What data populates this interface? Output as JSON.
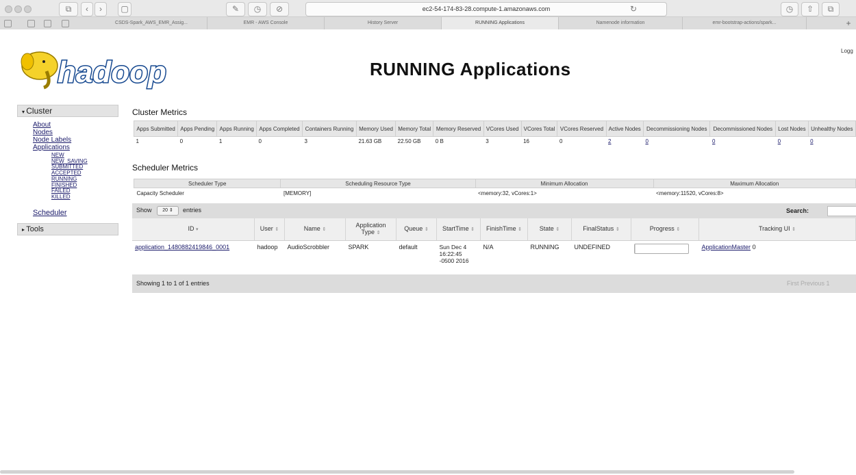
{
  "browser": {
    "url": "ec2-54-174-83-28.compute-1.amazonaws.com",
    "tabs": [
      {
        "label": "CSDS-Spark_AWS_EMR_Assig...",
        "active": false
      },
      {
        "label": "EMR - AWS Console",
        "active": false
      },
      {
        "label": "History Server",
        "active": false
      },
      {
        "label": "RUNNING Applications",
        "active": true
      },
      {
        "label": "Namenode information",
        "active": false
      },
      {
        "label": "emr-bootstrap-actions/spark...",
        "active": false
      }
    ]
  },
  "header": {
    "logo_text": "hadoop",
    "title": "RUNNING Applications",
    "logged_in": "Logg"
  },
  "sidebar": {
    "cluster_label": "Cluster",
    "links": [
      "About",
      "Nodes",
      "Node Labels",
      "Applications"
    ],
    "app_states": [
      "NEW",
      "NEW_SAVING",
      "SUBMITTED",
      "ACCEPTED",
      "RUNNING",
      "FINISHED",
      "FAILED",
      "KILLED"
    ],
    "scheduler": "Scheduler",
    "tools_label": "Tools"
  },
  "cluster_metrics": {
    "title": "Cluster Metrics",
    "headers": [
      "Apps Submitted",
      "Apps Pending",
      "Apps Running",
      "Apps Completed",
      "Containers Running",
      "Memory Used",
      "Memory Total",
      "Memory Reserved",
      "VCores Used",
      "VCores Total",
      "VCores Reserved",
      "Active Nodes",
      "Decommissioning Nodes",
      "Decommissioned Nodes",
      "Lost Nodes",
      "Unhealthy Nodes"
    ],
    "values": [
      "1",
      "0",
      "1",
      "0",
      "3",
      "21.63 GB",
      "22.50 GB",
      "0 B",
      "3",
      "16",
      "0",
      "2",
      "0",
      "0",
      "0",
      "0"
    ]
  },
  "scheduler_metrics": {
    "title": "Scheduler Metrics",
    "headers": [
      "Scheduler Type",
      "Scheduling Resource Type",
      "Minimum Allocation",
      "Maximum Allocation"
    ],
    "values": [
      "Capacity Scheduler",
      "[MEMORY]",
      "<memory:32, vCores:1>",
      "<memory:11520, vCores:8>"
    ]
  },
  "apps_table": {
    "show_label": "Show",
    "page_size": "20",
    "entries_label": "entries",
    "search_label": "Search:",
    "headers": [
      "ID",
      "User",
      "Name",
      "Application Type",
      "Queue",
      "StartTime",
      "FinishTime",
      "State",
      "FinalStatus",
      "Progress",
      "Tracking UI"
    ],
    "rows": [
      {
        "id": "application_1480882419846_0001",
        "user": "hadoop",
        "name": "AudioScrobbler",
        "type": "SPARK",
        "queue": "default",
        "start_time": "Sun Dec 4 16:22:45 -0500 2016",
        "finish_time": "N/A",
        "state": "RUNNING",
        "final_status": "UNDEFINED",
        "progress": 0.02,
        "tracking_ui": "ApplicationMaster",
        "extra": "0"
      }
    ],
    "showing": "Showing 1 to 1 of 1 entries",
    "pager": "First  Previous  1"
  }
}
